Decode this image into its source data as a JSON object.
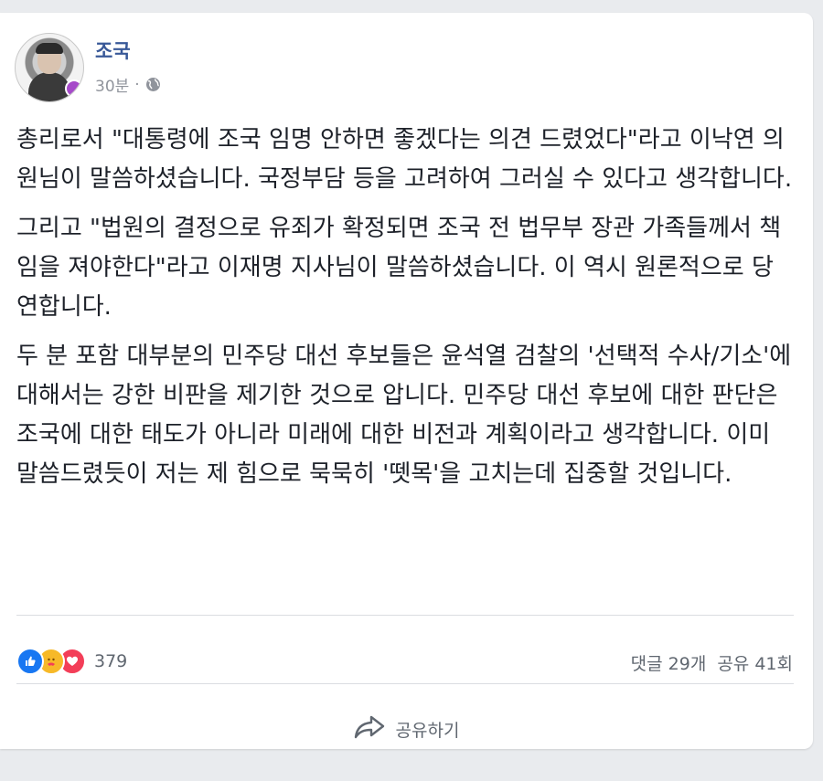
{
  "post": {
    "author": "조국",
    "time": "30분",
    "separator": "·",
    "privacy_icon": "globe-icon",
    "paragraphs": [
      "총리로서 \"대통령에 조국 임명 안하면 좋겠다는 의견 드렸었다\"라고 이낙연 의원님이 말씀하셨습니다. 국정부담 등을 고려하여 그러실 수 있다고 생각합니다.",
      "그리고 \"법원의 결정으로 유죄가 확정되면 조국 전 법무부 장관 가족들께서 책임을 져야한다\"라고 이재명 지사님이 말씀하셨습니다. 이 역시 원론적으로 당연합니다.",
      "두 분 포함 대부분의 민주당 대선 후보들은 윤석열 검찰의 '선택적 수사/기소'에 대해서는 강한 비판을 제기한 것으로 압니다. 민주당 대선 후보에 대한 판단은 조국에 대한 태도가 아니라 미래에 대한 비전과 계획이라고 생각합니다. 이미 말씀드렸듯이 저는 제 힘으로 묵묵히 '뗏목'을 고치는데 집중할 것입니다."
    ]
  },
  "engagement": {
    "reaction_icons": [
      "like-icon",
      "care-icon",
      "love-icon"
    ],
    "reaction_count": "379",
    "comments": "댓글 29개",
    "shares": "공유 41회"
  },
  "actions": {
    "share_label": "공유하기",
    "share_icon": "share-arrow-icon"
  },
  "colors": {
    "author": "#385898",
    "like": "#1877f2",
    "care": "#f7b928",
    "love": "#f33e58",
    "secondary_text": "#606770"
  }
}
